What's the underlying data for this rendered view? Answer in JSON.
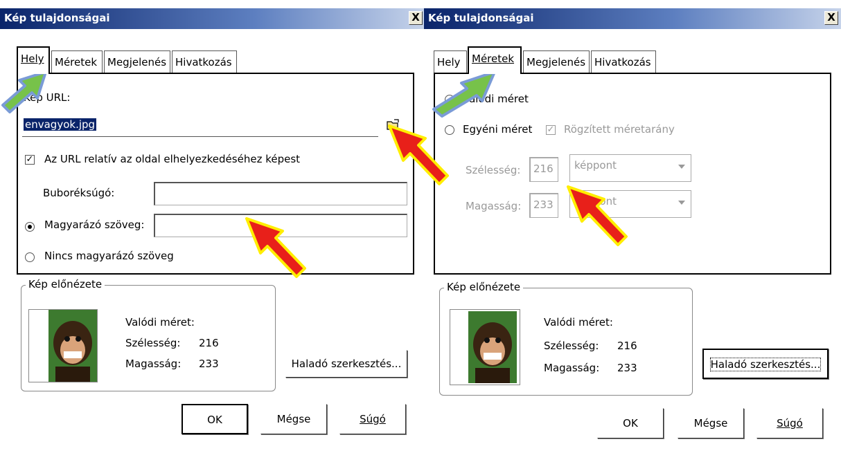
{
  "left": {
    "title": "Kép tulajdonságai",
    "close": "X",
    "tabs": [
      "Hely",
      "Méretek",
      "Megjelenés",
      "Hivatkozás"
    ],
    "url_label": "Kép URL:",
    "url_value": "envagyok.jpg",
    "relative_label": "Az URL relatív az oldal elhelyezkedéséhez képest",
    "tooltip_label": "Buboréksúgó:",
    "alt_label": "Magyarázó szöveg:",
    "noalt_label": "Nincs magyarázó szöveg",
    "preview_legend": "Kép előnézete",
    "real_size": "Valódi méret:",
    "width_label": "Szélesség:",
    "width_value": "216",
    "height_label": "Magasság:",
    "height_value": "233",
    "advanced": "Haladó szerkesztés...",
    "ok": "OK",
    "cancel": "Mégse",
    "help": "Súgó"
  },
  "right": {
    "title": "Kép tulajdonságai",
    "close": "X",
    "tabs": [
      "Hely",
      "Méretek",
      "Megjelenés",
      "Hivatkozás"
    ],
    "real_size_option": "Valódi méret",
    "custom_size_option": "Egyéni méret",
    "keep_ratio": "Rögzített méretarány",
    "width_label": "Szélesség:",
    "width_value": "216",
    "height_label": "Magasság:",
    "height_value": "233",
    "unit": "képpont",
    "unit2": "képpont",
    "preview_legend": "Kép előnézete",
    "real_size": "Valódi méret:",
    "pv_width_label": "Szélesség:",
    "pv_width_value": "216",
    "pv_height_label": "Magasság:",
    "pv_height_value": "233",
    "advanced": "Haladó szerkesztés...",
    "ok": "OK",
    "cancel": "Mégse",
    "help": "Súgó"
  },
  "colors": {
    "titlebar": "#0a246a",
    "arrow_red": "#e8201a",
    "arrow_yellow": "#ffee00",
    "arrow_green": "#77c24a",
    "arrow_blue": "#7a9bd6"
  },
  "icons": [
    "folder-browse-icon",
    "monkey-preview-image",
    "red-pointer-arrow-icon",
    "green-pointer-arrow-icon"
  ]
}
